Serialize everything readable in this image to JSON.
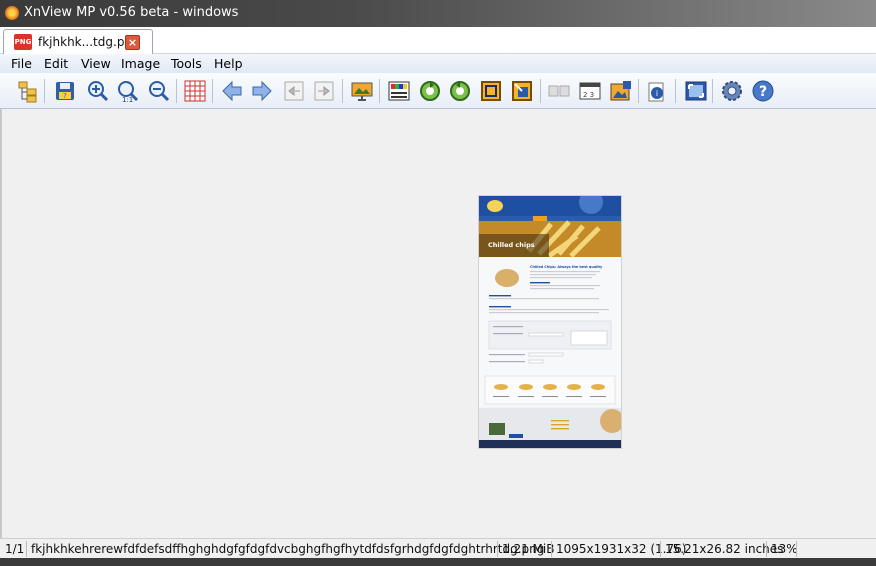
{
  "window": {
    "title": "XnView MP v0.56 beta - windows"
  },
  "tab": {
    "label": "fkjhkhk...tdg.png",
    "icon": "png-file-icon",
    "close_icon": "close-icon"
  },
  "menu": [
    "File",
    "Edit",
    "View",
    "Image",
    "Tools",
    "Help"
  ],
  "toolbar": [
    "browser-icon",
    "save-icon",
    "zoom-in-icon",
    "zoom-1-1-icon",
    "zoom-out-icon",
    "grid-icon",
    "previous-icon",
    "next-icon",
    "first-icon",
    "last-icon",
    "slideshow-icon",
    "adjust-icon",
    "rotate-left-icon",
    "rotate-right-icon",
    "crop-icon",
    "resize-icon",
    "compare-icon",
    "multipage-icon",
    "edit-icon",
    "properties-icon",
    "fullscreen-icon",
    "settings-icon",
    "help-icon"
  ],
  "thumbnail": {
    "hero_title": "Chilled chips",
    "section_heading": "Chilled Chips: Always the best quality"
  },
  "status": {
    "index": "1/1",
    "filename": "fkjhkhkehrerewfdfdefsdffhghghdgfgfdgfdvcbghgfhgfhytdfdsfgrhdgfdgfdghtrhrtdg.png",
    "filesize": "1.21 MiB",
    "dimensions": "1095x1931x32 (1.76)",
    "print_size": "15.21x26.82 inches",
    "zoom": "13%"
  },
  "colors": {
    "accent_blue": "#1f4fa0",
    "hero_gold": "#d79a2a"
  }
}
